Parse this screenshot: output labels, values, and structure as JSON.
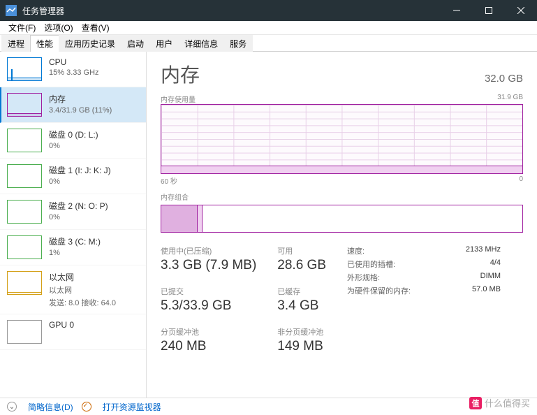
{
  "window": {
    "title": "任务管理器"
  },
  "menu": {
    "file": "文件(F)",
    "options": "选项(O)",
    "view": "查看(V)"
  },
  "tabs": [
    "进程",
    "性能",
    "应用历史记录",
    "启动",
    "用户",
    "详细信息",
    "服务"
  ],
  "sidebar": {
    "items": [
      {
        "title": "CPU",
        "sub": "15% 3.33 GHz",
        "type": "cpu"
      },
      {
        "title": "内存",
        "sub": "3.4/31.9 GB (11%)",
        "type": "mem"
      },
      {
        "title": "磁盘 0 (D: L:)",
        "sub": "0%",
        "type": "disk"
      },
      {
        "title": "磁盘 1 (I: J: K: J)",
        "sub": "0%",
        "type": "disk"
      },
      {
        "title": "磁盘 2 (N: O: P)",
        "sub": "0%",
        "type": "disk"
      },
      {
        "title": "磁盘 3 (C: M:)",
        "sub": "1%",
        "type": "disk"
      },
      {
        "title": "以太网",
        "sub": "以太网",
        "sub2": "发送: 8.0 接收: 64.0",
        "type": "net"
      },
      {
        "title": "GPU 0",
        "sub": "",
        "type": "gpu"
      }
    ]
  },
  "main": {
    "title": "内存",
    "total": "32.0 GB",
    "usage_label": "内存使用量",
    "usage_max": "31.9 GB",
    "x_start": "60 秒",
    "x_end": "0",
    "composition_label": "内存组合"
  },
  "stats": {
    "in_use_label": "使用中(已压缩)",
    "in_use_value": "3.3 GB (7.9 MB)",
    "available_label": "可用",
    "available_value": "28.6 GB",
    "committed_label": "已提交",
    "committed_value": "5.3/33.9 GB",
    "cached_label": "已缓存",
    "cached_value": "3.4 GB",
    "paged_label": "分页缓冲池",
    "paged_value": "240 MB",
    "nonpaged_label": "非分页缓冲池",
    "nonpaged_value": "149 MB"
  },
  "specs": {
    "speed_label": "速度:",
    "speed_value": "2133 MHz",
    "slots_label": "已使用的插槽:",
    "slots_value": "4/4",
    "form_label": "外形规格:",
    "form_value": "DIMM",
    "reserved_label": "为硬件保留的内存:",
    "reserved_value": "57.0 MB"
  },
  "footer": {
    "fewer": "简略信息(D)",
    "resmon": "打开资源监视器"
  },
  "watermark": "什么值得买",
  "chart_data": {
    "type": "area",
    "title": "内存使用量",
    "xlabel": "秒",
    "ylabel": "GB",
    "xlim": [
      60,
      0
    ],
    "ylim": [
      0,
      31.9
    ],
    "series": [
      {
        "name": "内存",
        "x": [
          60,
          50,
          40,
          30,
          20,
          10,
          0
        ],
        "values": [
          3.4,
          3.4,
          3.4,
          3.4,
          3.4,
          3.4,
          3.4
        ]
      }
    ]
  }
}
